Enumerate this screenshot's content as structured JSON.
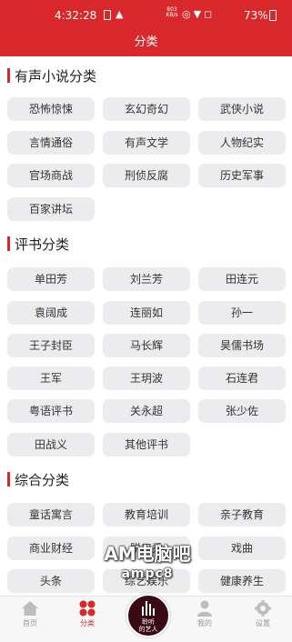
{
  "status": {
    "time": "4:32:28",
    "speed": "803 KB/s",
    "battery": "73%"
  },
  "header": {
    "title": "分类"
  },
  "sections": [
    {
      "title": "有声小说分类",
      "items": [
        "恐怖惊悚",
        "玄幻奇幻",
        "武侠小说",
        "言情通俗",
        "有声文学",
        "人物纪实",
        "官场商战",
        "刑侦反腐",
        "历史军事",
        "百家讲坛"
      ]
    },
    {
      "title": "评书分类",
      "items": [
        "单田芳",
        "刘兰芳",
        "田连元",
        "袁阔成",
        "连丽如",
        "孙一",
        "王子封臣",
        "马长辉",
        "昊儒书场",
        "王军",
        "王玥波",
        "石连君",
        "粤语评书",
        "关永超",
        "张少佐",
        "田战义",
        "其他评书"
      ]
    },
    {
      "title": "综合分类",
      "items": [
        "童话寓言",
        "教育培训",
        "亲子教育",
        "商业财经",
        "脱口秀",
        "戏曲",
        "头条",
        "综艺娱乐",
        "健康养生"
      ]
    }
  ],
  "watermark": {
    "line1": "AM电脑吧",
    "line2": "ampc8"
  },
  "nav": {
    "home": "首页",
    "category": "分类",
    "mine": "我的",
    "settings": "设置",
    "center_line1": "聆听",
    "center_line2": "的艺人"
  },
  "colors": {
    "accent": "#d8282b",
    "chip_bg": "#ececef"
  }
}
